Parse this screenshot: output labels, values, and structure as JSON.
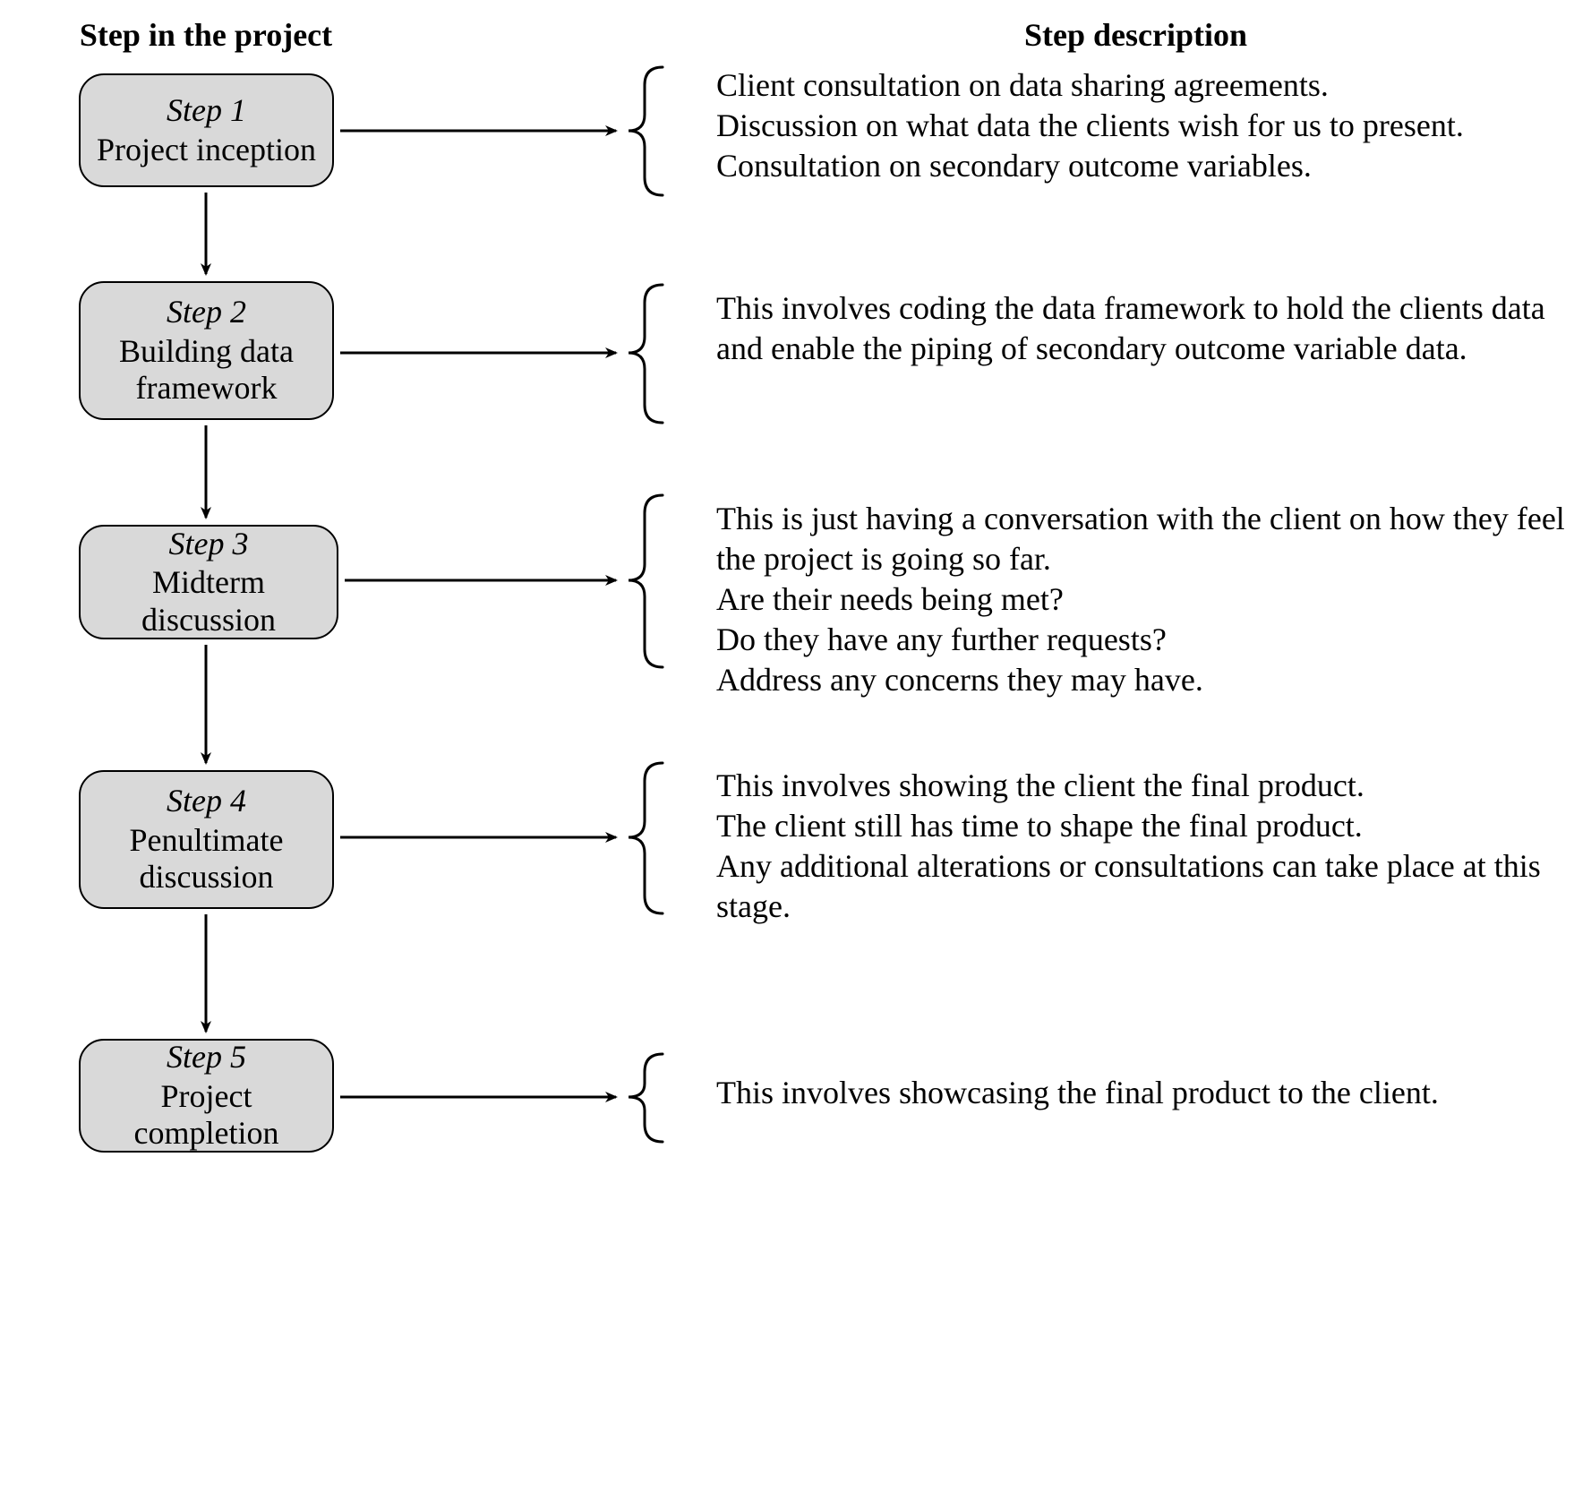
{
  "sections": {
    "left_title": "Step in the project",
    "right_title": "Step description"
  },
  "steps": [
    {
      "title": "Step 1",
      "label": "Project inception",
      "description": "Client consultation on data sharing agreements.\nDiscussion on what data the clients wish for us to present.\nConsultation on secondary outcome variables."
    },
    {
      "title": "Step 2",
      "label": "Building data framework",
      "description": "This involves coding the data framework to hold the clients data and enable the piping of secondary outcome variable data."
    },
    {
      "title": "Step 3",
      "label": "Midterm discussion",
      "description": "This is just having a conversation with the client on how they feel the project is going so far.\nAre their needs being met?\nDo they have any further requests?\nAddress any concerns they may have."
    },
    {
      "title": "Step 4",
      "label": "Penultimate discussion",
      "description": "This involves showing the client the final product.\nThe client still has time to shape the final product.\nAny additional alterations or consultations can take place at this stage."
    },
    {
      "title": "Step 5",
      "label": "Project completion",
      "description": "This involves showcasing the final product to the client."
    }
  ],
  "colors": {
    "box_fill": "#d9d9d9",
    "border": "#000000",
    "bg": "#ffffff"
  }
}
